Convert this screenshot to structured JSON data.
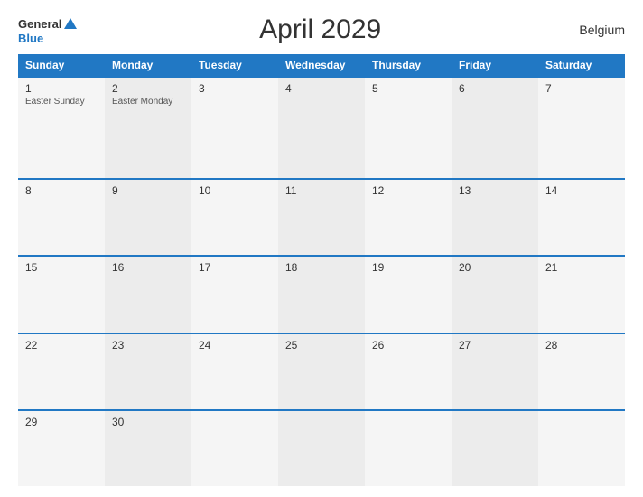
{
  "header": {
    "logo_general": "General",
    "logo_blue": "Blue",
    "title": "April 2029",
    "country": "Belgium"
  },
  "calendar": {
    "weekdays": [
      "Sunday",
      "Monday",
      "Tuesday",
      "Wednesday",
      "Thursday",
      "Friday",
      "Saturday"
    ],
    "weeks": [
      [
        {
          "day": "1",
          "holiday": "Easter Sunday"
        },
        {
          "day": "2",
          "holiday": "Easter Monday"
        },
        {
          "day": "3",
          "holiday": ""
        },
        {
          "day": "4",
          "holiday": ""
        },
        {
          "day": "5",
          "holiday": ""
        },
        {
          "day": "6",
          "holiday": ""
        },
        {
          "day": "7",
          "holiday": ""
        }
      ],
      [
        {
          "day": "8",
          "holiday": ""
        },
        {
          "day": "9",
          "holiday": ""
        },
        {
          "day": "10",
          "holiday": ""
        },
        {
          "day": "11",
          "holiday": ""
        },
        {
          "day": "12",
          "holiday": ""
        },
        {
          "day": "13",
          "holiday": ""
        },
        {
          "day": "14",
          "holiday": ""
        }
      ],
      [
        {
          "day": "15",
          "holiday": ""
        },
        {
          "day": "16",
          "holiday": ""
        },
        {
          "day": "17",
          "holiday": ""
        },
        {
          "day": "18",
          "holiday": ""
        },
        {
          "day": "19",
          "holiday": ""
        },
        {
          "day": "20",
          "holiday": ""
        },
        {
          "day": "21",
          "holiday": ""
        }
      ],
      [
        {
          "day": "22",
          "holiday": ""
        },
        {
          "day": "23",
          "holiday": ""
        },
        {
          "day": "24",
          "holiday": ""
        },
        {
          "day": "25",
          "holiday": ""
        },
        {
          "day": "26",
          "holiday": ""
        },
        {
          "day": "27",
          "holiday": ""
        },
        {
          "day": "28",
          "holiday": ""
        }
      ],
      [
        {
          "day": "29",
          "holiday": ""
        },
        {
          "day": "30",
          "holiday": ""
        },
        {
          "day": "",
          "holiday": ""
        },
        {
          "day": "",
          "holiday": ""
        },
        {
          "day": "",
          "holiday": ""
        },
        {
          "day": "",
          "holiday": ""
        },
        {
          "day": "",
          "holiday": ""
        }
      ]
    ]
  }
}
